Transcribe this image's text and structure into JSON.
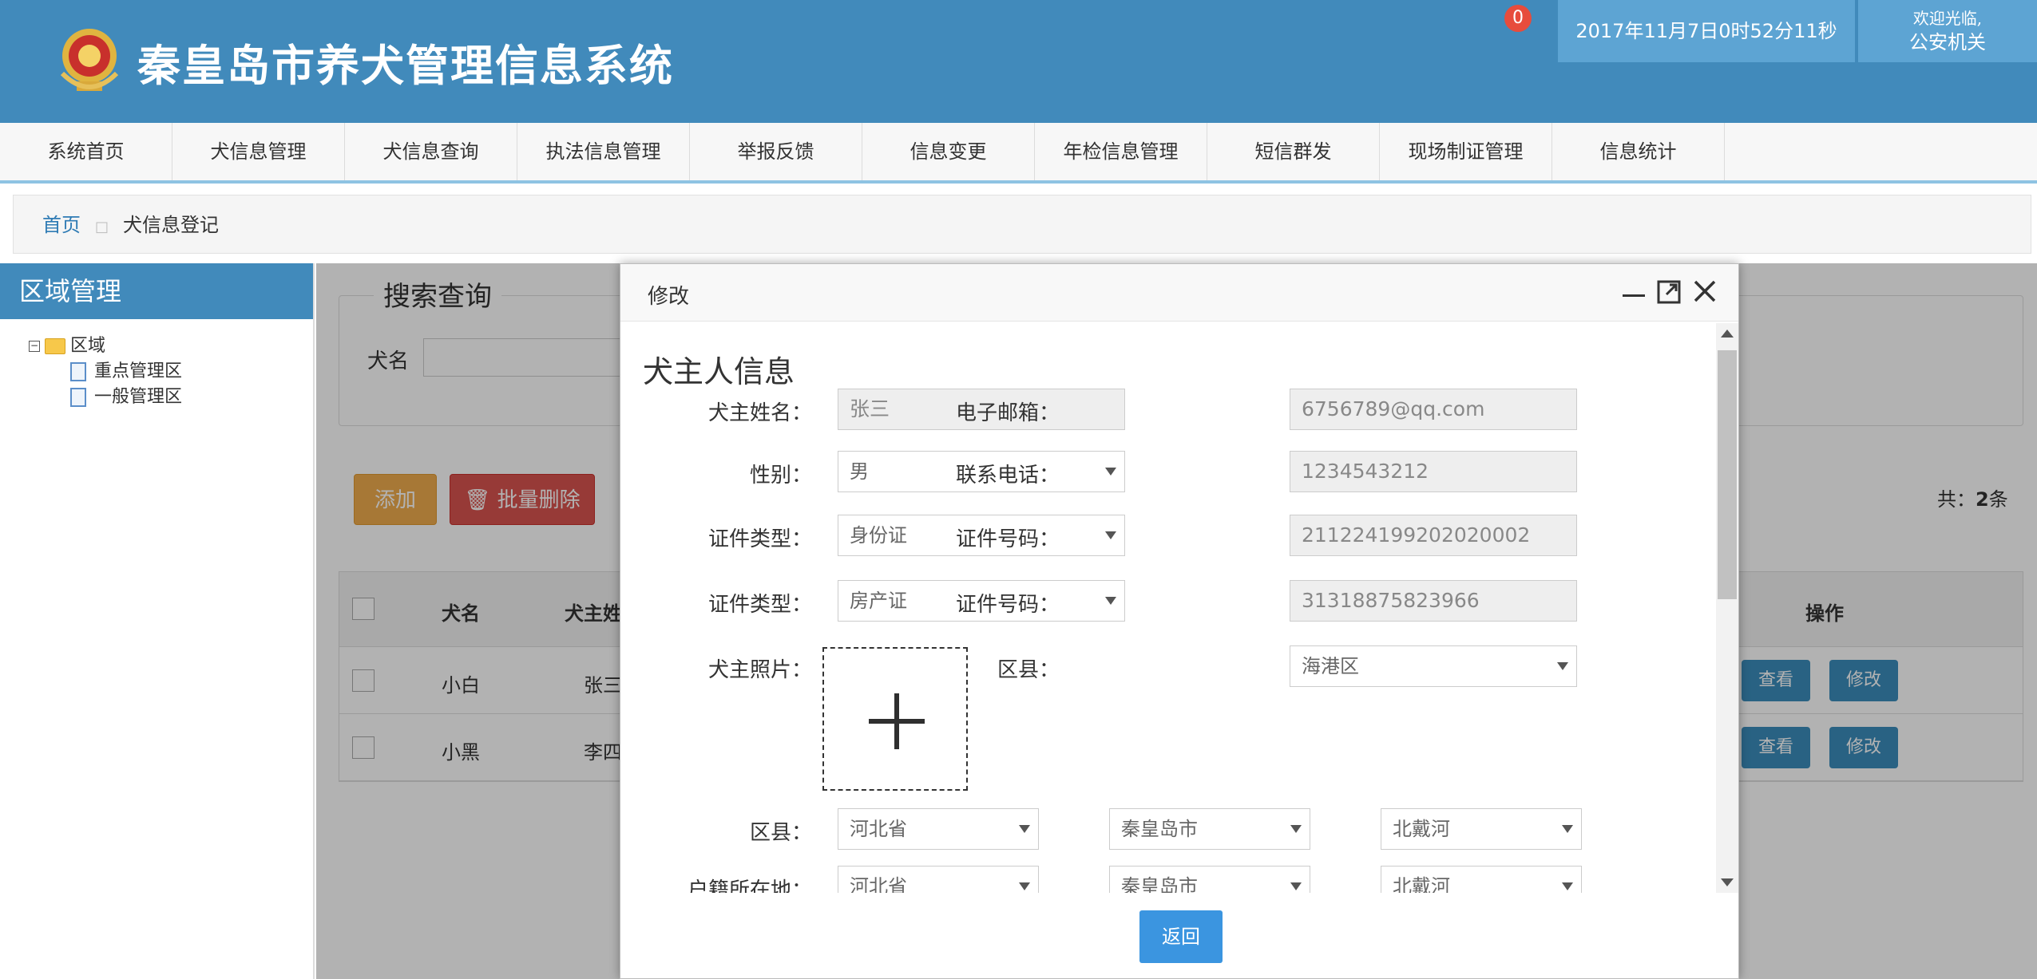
{
  "header": {
    "title": "秦皇岛市养犬管理信息系统",
    "notification_count": "0",
    "datetime": "2017年11月7日0时52分11秒",
    "welcome_line1": "欢迎光临,",
    "welcome_line2": "公安机关"
  },
  "nav": {
    "items": [
      "系统首页",
      "犬信息管理",
      "犬信息查询",
      "执法信息管理",
      "举报反馈",
      "信息变更",
      "年检信息管理",
      "短信群发",
      "现场制证管理",
      "信息统计"
    ]
  },
  "breadcrumb": {
    "home": "首页",
    "separator": "□",
    "current": "犬信息登记"
  },
  "sidebar": {
    "title": "区域管理",
    "root": "区域",
    "children": [
      "重点管理区",
      "一般管理区"
    ]
  },
  "main": {
    "search_legend": "搜索查询",
    "search_label": "犬名",
    "add_button": "添加",
    "batch_delete_button": "批量删除",
    "total_prefix": "共：",
    "total_count": "2",
    "total_suffix": "条",
    "table": {
      "headers": [
        "犬名",
        "犬主姓",
        "操作"
      ],
      "rows": [
        {
          "dog_name": "小白",
          "owner": "张三",
          "view": "查看",
          "edit": "修改"
        },
        {
          "dog_name": "小黑",
          "owner": "李四",
          "view": "查看",
          "edit": "修改"
        }
      ]
    }
  },
  "dialog": {
    "title": "修改",
    "section_title": "犬主人信息",
    "fields": {
      "owner_name_label": "犬主姓名：",
      "owner_name_value": "张三",
      "email_label": "电子邮箱：",
      "email_value": "6756789@qq.com",
      "gender_label": "性别：",
      "gender_value": "男",
      "phone_label": "联系电话：",
      "phone_value": "1234543212",
      "id_type_label_1": "证件类型：",
      "id_type_value_1": "身份证",
      "id_no_label_1": "证件号码：",
      "id_no_value_1": "211224199202020002",
      "id_type_label_2": "证件类型：",
      "id_type_value_2": "房产证",
      "id_no_label_2": "证件号码：",
      "id_no_value_2": "31318875823966",
      "photo_label": "犬主照片：",
      "district_label_right": "区县：",
      "district_value_right": "海港区",
      "district_label": "区县：",
      "province_value": "河北省",
      "city_value": "秦皇岛市",
      "county_value": "北戴河",
      "residence_label": "户籍所在地：",
      "residence_province": "河北省",
      "residence_city": "秦皇岛市",
      "residence_county": "北戴河"
    },
    "return_button": "返回"
  },
  "colors": {
    "header_bg": "#418abb",
    "accent_blue": "#3c8dbc",
    "warning": "#f0ad4e",
    "danger": "#d9534f"
  }
}
